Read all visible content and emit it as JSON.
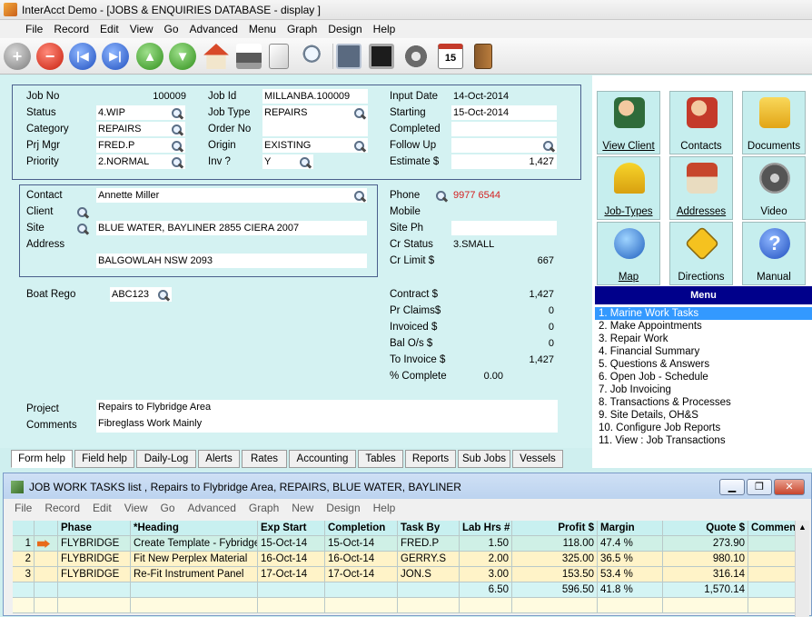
{
  "window": {
    "title": "InterAcct Demo - [JOBS & ENQUIRIES DATABASE - display ]"
  },
  "menubar": [
    "File",
    "Record",
    "Edit",
    "View",
    "Go",
    "Advanced",
    "Menu",
    "Graph",
    "Design",
    "Help"
  ],
  "toolbar": {
    "icons": [
      "add-icon",
      "delete-icon",
      "first-icon",
      "last-icon",
      "up-icon",
      "down-icon",
      "home-icon",
      "print-icon",
      "document-icon",
      "search-icon",
      "calculator-icon",
      "monitor-icon",
      "settings-icon",
      "calendar-icon",
      "exit-door-icon"
    ],
    "calendar_day": "15"
  },
  "job": {
    "job_no_label": "Job No",
    "job_no": "100009",
    "status_label": "Status",
    "status": "4.WIP",
    "category_label": "Category",
    "category": "REPAIRS",
    "prj_mgr_label": "Prj Mgr",
    "prj_mgr": "FRED.P",
    "priority_label": "Priority",
    "priority": "2.NORMAL",
    "job_id_label": "Job Id",
    "job_id": "MILLANBA.100009",
    "job_type_label": "Job Type",
    "job_type": "REPAIRS",
    "order_no_label": "Order No",
    "order_no": "",
    "origin_label": "Origin",
    "origin": "EXISTING",
    "inv_label": "Inv ?",
    "inv": "Y",
    "input_date_label": "Input Date",
    "input_date": "14-Oct-2014",
    "starting_label": "Starting",
    "starting": "15-Oct-2014",
    "completed_label": "Completed",
    "completed": "",
    "follow_up_label": "Follow Up",
    "follow_up": "",
    "estimate_label": "Estimate $",
    "estimate": "1,427"
  },
  "contact": {
    "contact_label": "Contact",
    "contact": "Annette Miller",
    "client_label": "Client",
    "site_label": "Site",
    "site": "BLUE WATER, BAYLINER 2855 CIERA 2007",
    "address_label": "Address",
    "address": "BALGOWLAH NSW 2093",
    "phone_label": "Phone",
    "phone": "9977 6544",
    "mobile_label": "Mobile",
    "mobile": "",
    "site_ph_label": "Site Ph",
    "site_ph": "",
    "cr_status_label": "Cr Status",
    "cr_status": "3.SMALL",
    "cr_limit_label": "Cr Limit $",
    "cr_limit": "667"
  },
  "boat": {
    "label": "Boat Rego",
    "value": "ABC123"
  },
  "financial": {
    "contract_label": "Contract $",
    "contract": "1,427",
    "pr_claims_label": "Pr Claims$",
    "pr_claims": "0",
    "invoiced_label": "Invoiced $",
    "invoiced": "0",
    "bal_os_label": "Bal O/s $",
    "bal_os": "0",
    "to_invoice_label": "To Invoice $",
    "to_invoice": "1,427",
    "pct_complete_label": "% Complete",
    "pct_complete": "0.00"
  },
  "project": {
    "project_label": "Project",
    "project": "Repairs to Flybridge Area",
    "comments_label": "Comments",
    "comments": "Fibreglass Work Mainly"
  },
  "tiles": [
    {
      "label": "View Client",
      "icon": "view-client-icon"
    },
    {
      "label": "Contacts",
      "icon": "contacts-icon"
    },
    {
      "label": "Documents",
      "icon": "documents-icon"
    },
    {
      "label": "Job-Types",
      "icon": "job-types-icon"
    },
    {
      "label": "Addresses",
      "icon": "addresses-icon"
    },
    {
      "label": "Video",
      "icon": "video-icon"
    },
    {
      "label": "Map",
      "icon": "map-icon"
    },
    {
      "label": "Directions",
      "icon": "directions-icon"
    },
    {
      "label": "Manual",
      "icon": "manual-icon"
    }
  ],
  "menu": {
    "title": "Menu",
    "items": [
      "1. Marine Work Tasks",
      "2. Make Appointments",
      "3. Repair Work",
      "4. Financial Summary",
      "5. Questions & Answers",
      "6. Open Job - Schedule",
      "7. Job Invoicing",
      "8. Transactions & Processes",
      "9. Site Details, OH&S",
      "10. Configure Job Reports",
      "11. View : Job Transactions"
    ],
    "selected_index": 0
  },
  "tabs": [
    "Form help",
    "Field help",
    "Daily-Log",
    "Alerts",
    "Rates",
    "Accounting",
    "Tables",
    "Reports",
    "Sub Jobs",
    "Vessels"
  ],
  "subwindow": {
    "title": "JOB WORK TASKS list , Repairs to Flybridge Area, REPAIRS, BLUE WATER, BAYLINER",
    "menu": [
      "File",
      "Record",
      "Edit",
      "View",
      "Go",
      "Advanced",
      "Graph",
      "New",
      "Design",
      "Help"
    ],
    "columns": [
      "Phase",
      "*Heading",
      "Exp Start",
      "Completion",
      "Task By",
      "Lab Hrs #",
      "Profit $",
      "Margin",
      "Quote $",
      "Comment"
    ],
    "rows": [
      {
        "n": "1",
        "phase": "FLYBRIDGE",
        "heading": "Create Template - Fybridge",
        "exp_start": "15-Oct-14",
        "completion": "15-Oct-14",
        "task_by": "FRED.P",
        "lab_hrs": "1.50",
        "profit": "118.00",
        "margin": "47.4 %",
        "quote": "273.90",
        "comment": ""
      },
      {
        "n": "2",
        "phase": "FLYBRIDGE",
        "heading": "Fit New Perplex Material",
        "exp_start": "16-Oct-14",
        "completion": "16-Oct-14",
        "task_by": "GERRY.S",
        "lab_hrs": "2.00",
        "profit": "325.00",
        "margin": "36.5 %",
        "quote": "980.10",
        "comment": ""
      },
      {
        "n": "3",
        "phase": "FLYBRIDGE",
        "heading": "Re-Fit Instrument Panel",
        "exp_start": "17-Oct-14",
        "completion": "17-Oct-14",
        "task_by": "JON.S",
        "lab_hrs": "3.00",
        "profit": "153.50",
        "margin": "53.4 %",
        "quote": "316.14",
        "comment": ""
      }
    ],
    "totals": {
      "lab_hrs": "6.50",
      "profit": "596.50",
      "margin": "41.8 %",
      "quote": "1,570.14"
    }
  }
}
